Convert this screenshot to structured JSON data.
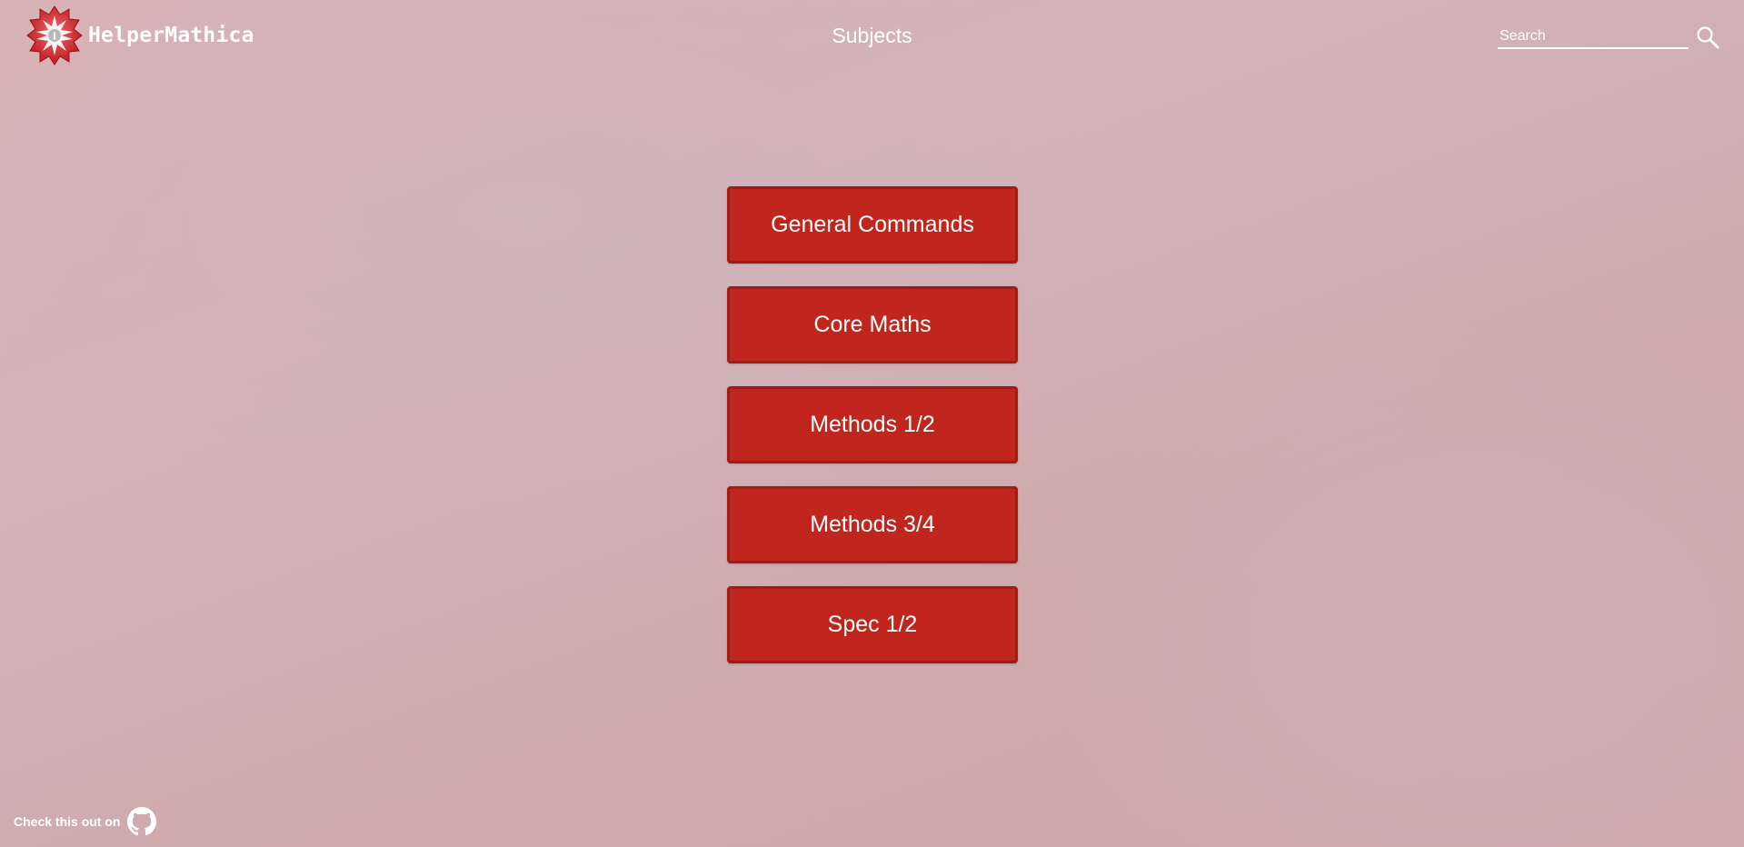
{
  "header": {
    "brand_name": "HelperMathica",
    "page_title": "Subjects",
    "search": {
      "placeholder": "Search",
      "value": ""
    }
  },
  "menu": {
    "items": [
      {
        "label": "General Commands"
      },
      {
        "label": "Core Maths"
      },
      {
        "label": "Methods 1/2"
      },
      {
        "label": "Methods 3/4"
      },
      {
        "label": "Spec 1/2"
      }
    ]
  },
  "footer": {
    "text": "Check this out on"
  },
  "icons": {
    "logo": "mathematica-spikey-logo-icon",
    "search": "search-icon",
    "footer_link": "github-icon"
  },
  "colors": {
    "button_bg": "#c0261d",
    "button_border": "#9e1d16",
    "text": "#ffffff"
  }
}
